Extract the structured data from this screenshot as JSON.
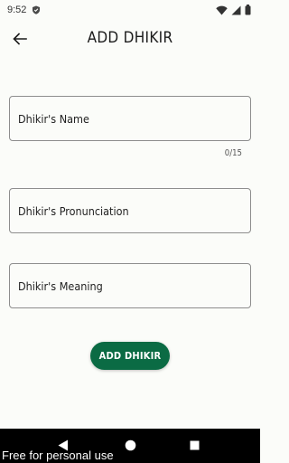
{
  "status_bar": {
    "time": "9:52",
    "icons": [
      "shield-icon",
      "wifi-icon",
      "signal-icon",
      "battery-icon"
    ]
  },
  "app_bar": {
    "title": "ADD DHIKIR",
    "back_icon": "arrow-left-icon"
  },
  "form": {
    "name_placeholder": "Dhikir's Name",
    "name_value": "",
    "name_counter": "0/15",
    "pronunciation_placeholder": "Dhikir's Pronunciation",
    "pronunciation_value": "",
    "meaning_placeholder": "Dhikir's Meaning",
    "meaning_value": "",
    "submit_label": "ADD DHIKIR"
  },
  "nav_bar": {
    "icons": [
      "back-triangle-icon",
      "home-circle-icon",
      "recents-square-icon"
    ]
  },
  "watermark": "Free for personal use",
  "colors": {
    "background": "#fbfcf9",
    "accent": "#0b6b44",
    "border": "#8d8d8d",
    "nav_bar": "#000000"
  }
}
